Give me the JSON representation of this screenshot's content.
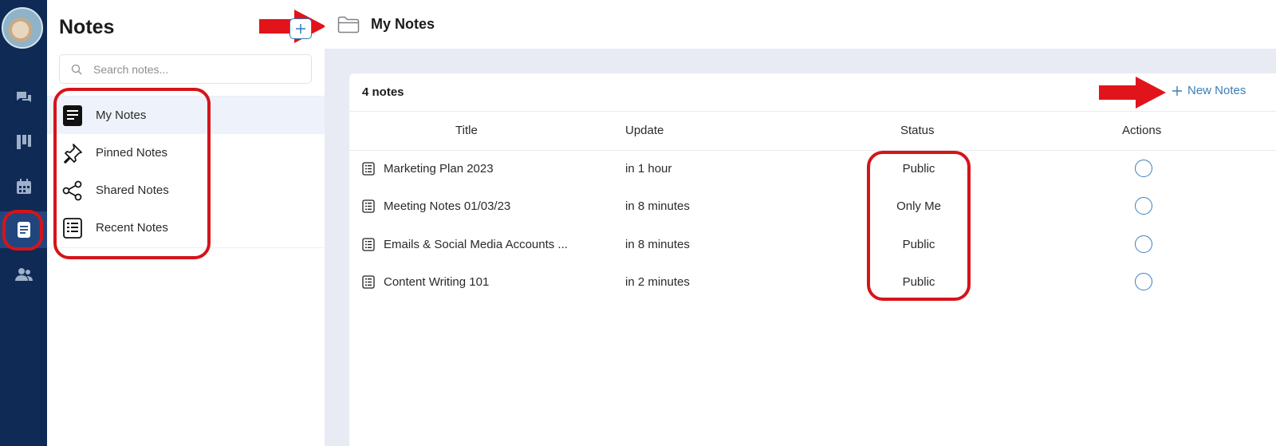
{
  "app": {
    "panel_title": "Notes",
    "search_placeholder": "Search notes...",
    "topbar_title": "My Notes"
  },
  "sidebar": {
    "items": [
      {
        "label": "My Notes",
        "icon": "note-icon",
        "active": true
      },
      {
        "label": "Pinned Notes",
        "icon": "pin-icon",
        "active": false
      },
      {
        "label": "Shared Notes",
        "icon": "share-icon",
        "active": false
      },
      {
        "label": "Recent Notes",
        "icon": "list-icon",
        "active": false
      }
    ]
  },
  "rail": {
    "icons": [
      "chat-icon",
      "board-icon",
      "calendar-icon",
      "notes-icon",
      "team-icon"
    ],
    "active": "notes-icon"
  },
  "table": {
    "count_label": "4 notes",
    "new_label": "New Notes",
    "columns": [
      "Title",
      "Update",
      "Status",
      "Actions"
    ],
    "rows": [
      {
        "title": "Marketing Plan 2023",
        "update": "in 1 hour",
        "status": "Public"
      },
      {
        "title": "Meeting Notes 01/03/23",
        "update": "in 8 minutes",
        "status": "Only Me"
      },
      {
        "title": "Emails & Social Media Accounts ...",
        "update": "in 8 minutes",
        "status": "Public"
      },
      {
        "title": "Content Writing 101",
        "update": "in 2 minutes",
        "status": "Public"
      }
    ]
  },
  "colors": {
    "rail": "#0f2a55",
    "accent": "#3a7fb8",
    "annotation_red": "#d5141a",
    "main_bg": "#e9ebf4"
  }
}
